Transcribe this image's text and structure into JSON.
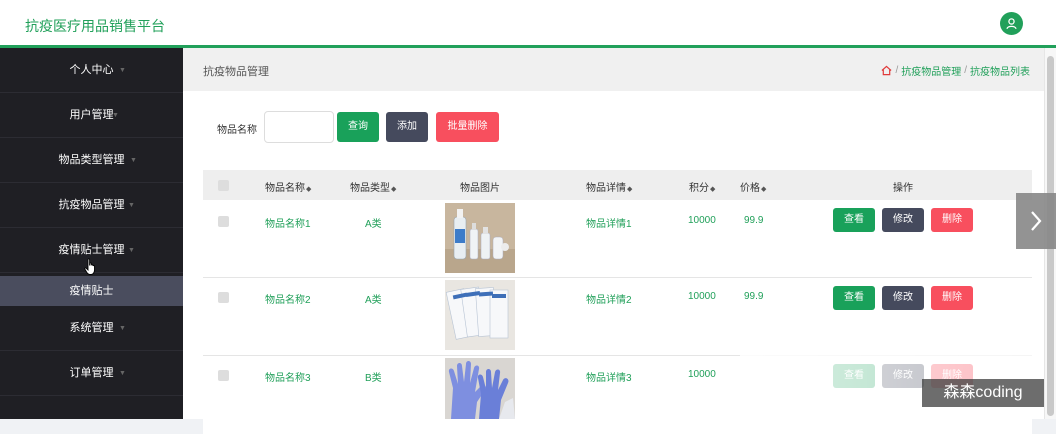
{
  "app": {
    "title": "抗疫医疗用品销售平台"
  },
  "sidebar": {
    "items": [
      {
        "label": "个人中心"
      },
      {
        "label": "用户管理"
      },
      {
        "label": "物品类型管理"
      },
      {
        "label": "抗疫物品管理"
      },
      {
        "label": "疫情贴士管理"
      },
      {
        "label": "系统管理"
      },
      {
        "label": "订单管理"
      }
    ],
    "active_sub": "疫情贴士"
  },
  "crumbbar": {
    "title": "抗疫物品管理",
    "breadcrumbs": [
      "抗疫物品管理",
      "抗疫物品列表"
    ],
    "separator": "/"
  },
  "search": {
    "label": "物品名称",
    "value": "",
    "placeholder": "",
    "query_label": "查询",
    "add_label": "添加",
    "batch_delete_label": "批量删除"
  },
  "table": {
    "columns": [
      "物品名称",
      "物品类型",
      "物品图片",
      "物品详情",
      "积分",
      "价格",
      "操作"
    ],
    "actions": {
      "view": "查看",
      "edit": "修改",
      "delete": "删除"
    },
    "rows": [
      {
        "name": "物品名称1",
        "type": "A类",
        "detail": "物品详情1",
        "points": "10000",
        "price": "99.9"
      },
      {
        "name": "物品名称2",
        "type": "A类",
        "detail": "物品详情2",
        "points": "10000",
        "price": "99.9"
      },
      {
        "name": "物品名称3",
        "type": "B类",
        "detail": "物品详情3",
        "points": "10000",
        "price": ""
      }
    ]
  },
  "watermark": "森森coding",
  "colors": {
    "accent": "#21a05a",
    "dark": "#1f1f24",
    "danger": "#f84f5e",
    "slate": "#454a5d"
  }
}
